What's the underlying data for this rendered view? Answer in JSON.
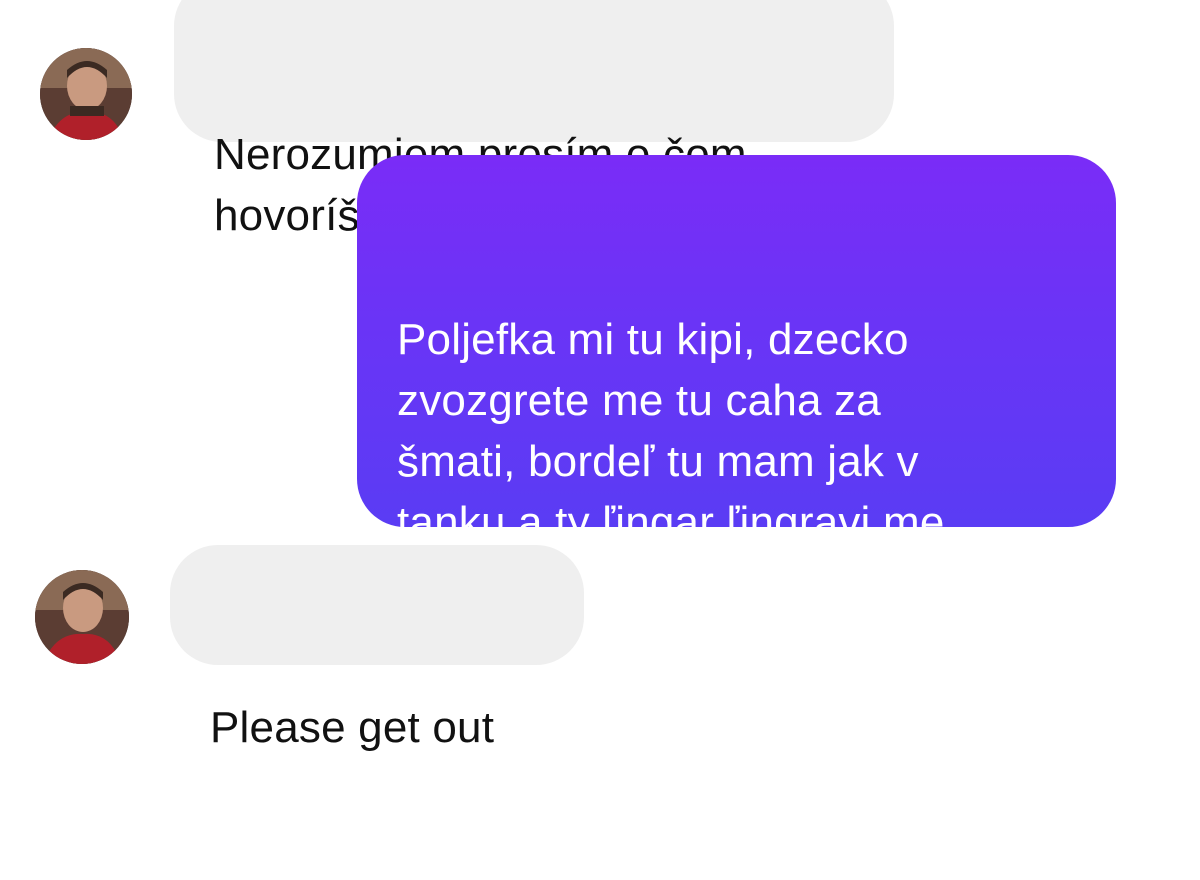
{
  "conversation": {
    "messages": [
      {
        "direction": "incoming",
        "text": "Nerozumiem prosím o čom\nhovoríš",
        "avatar": "profile-photo-man-red-shirt"
      },
      {
        "direction": "outgoing",
        "text": "Poljefka mi tu kipi, dzecko\nzvozgrete me tu caha za\nšmati, bordeľ tu mam jak v\ntanku a ty ľingar ľingravi me\ntu ľem zabavjaš"
      },
      {
        "direction": "incoming",
        "text": "Please get out",
        "avatar": "profile-photo-man-red-shirt"
      }
    ]
  },
  "colors": {
    "incoming_bubble": "#efefef",
    "outgoing_bubble_top": "#7a2cf7",
    "outgoing_bubble_bottom": "#5a3cf4",
    "incoming_text": "#111111",
    "outgoing_text": "#ffffff"
  }
}
